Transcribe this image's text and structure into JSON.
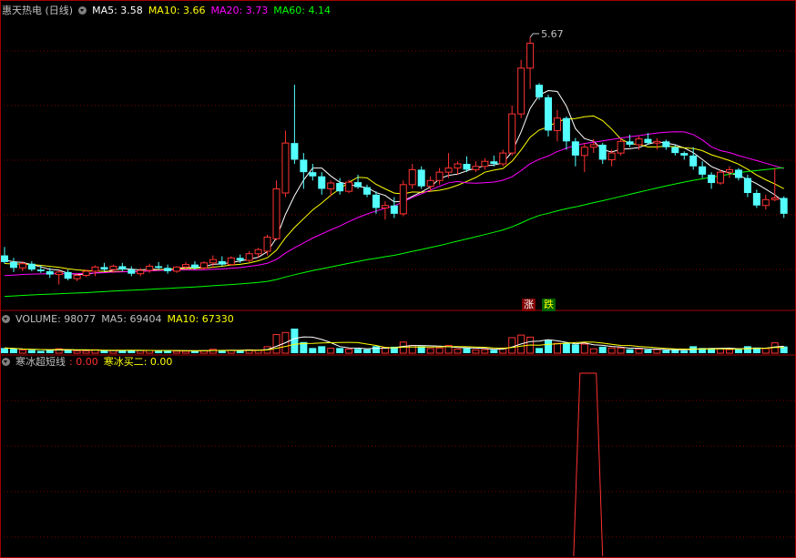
{
  "main_pane": {
    "title": "惠天热电 (日线)",
    "indicators": [
      {
        "label": "MA5: 3.58",
        "color": "#ffffff"
      },
      {
        "label": "MA10: 3.66",
        "color": "#ffff00"
      },
      {
        "label": "MA20: 3.73",
        "color": "#ff00ff"
      },
      {
        "label": "MA60: 4.14",
        "color": "#00ff00"
      }
    ],
    "high_label": "5.67",
    "tag_rise": "涨",
    "tag_fall": "跌"
  },
  "volume_pane": {
    "indicators": [
      {
        "label": "VOLUME: 98077",
        "color": "#c0c0c0"
      },
      {
        "label": "MA5: 69404",
        "color": "#c0c0c0"
      },
      {
        "label": "MA10: 67330",
        "color": "#ffff00"
      }
    ]
  },
  "indicator_pane": {
    "title": "寒冰超短线",
    "indicators": [
      {
        "label": ": 0.00",
        "color": "#ff3030"
      },
      {
        "label": "寒冰买二: 0.00",
        "color": "#ffff00"
      }
    ]
  },
  "colors": {
    "up": "#ff3232",
    "down": "#54ffff",
    "grid": "#800000",
    "border": "#a00000"
  },
  "chart_data": {
    "type": "candlestick",
    "y_visible_range": [
      2.4,
      5.9
    ],
    "candles_ohlc": [
      [
        3.05,
        3.15,
        2.95,
        2.97
      ],
      [
        2.97,
        3.02,
        2.85,
        2.9
      ],
      [
        2.9,
        2.98,
        2.86,
        2.95
      ],
      [
        2.95,
        2.98,
        2.86,
        2.88
      ],
      [
        2.88,
        2.93,
        2.84,
        2.86
      ],
      [
        2.86,
        2.9,
        2.78,
        2.82
      ],
      [
        2.82,
        2.87,
        2.7,
        2.85
      ],
      [
        2.85,
        2.88,
        2.75,
        2.77
      ],
      [
        2.77,
        2.83,
        2.74,
        2.81
      ],
      [
        2.81,
        2.88,
        2.79,
        2.86
      ],
      [
        2.86,
        2.93,
        2.8,
        2.91
      ],
      [
        2.91,
        2.96,
        2.86,
        2.88
      ],
      [
        2.88,
        2.94,
        2.84,
        2.92
      ],
      [
        2.92,
        2.96,
        2.86,
        2.88
      ],
      [
        2.88,
        2.92,
        2.8,
        2.83
      ],
      [
        2.83,
        2.9,
        2.8,
        2.87
      ],
      [
        2.87,
        2.95,
        2.84,
        2.92
      ],
      [
        2.92,
        2.97,
        2.88,
        2.9
      ],
      [
        2.9,
        2.94,
        2.83,
        2.86
      ],
      [
        2.86,
        2.92,
        2.84,
        2.91
      ],
      [
        2.91,
        2.97,
        2.89,
        2.94
      ],
      [
        2.94,
        2.98,
        2.88,
        2.9
      ],
      [
        2.9,
        2.98,
        2.88,
        2.96
      ],
      [
        2.96,
        3.05,
        2.9,
        3.0
      ],
      [
        2.98,
        3.04,
        2.92,
        2.94
      ],
      [
        2.94,
        3.04,
        2.93,
        3.02
      ],
      [
        3.02,
        3.06,
        2.96,
        2.99
      ],
      [
        2.99,
        3.1,
        2.97,
        3.07
      ],
      [
        3.07,
        3.14,
        3.02,
        3.12
      ],
      [
        3.1,
        3.3,
        3.05,
        3.27
      ],
      [
        3.25,
        3.95,
        3.23,
        3.85
      ],
      [
        3.8,
        4.55,
        3.75,
        4.4
      ],
      [
        4.4,
        5.1,
        4.15,
        4.2
      ],
      [
        4.2,
        4.28,
        3.85,
        4.05
      ],
      [
        4.05,
        4.15,
        3.95,
        4.0
      ],
      [
        4.0,
        4.05,
        3.78,
        3.85
      ],
      [
        3.85,
        3.95,
        3.76,
        3.92
      ],
      [
        3.92,
        3.98,
        3.78,
        3.82
      ],
      [
        3.82,
        3.96,
        3.8,
        3.93
      ],
      [
        3.93,
        4.02,
        3.85,
        3.87
      ],
      [
        3.87,
        3.9,
        3.75,
        3.78
      ],
      [
        3.78,
        3.82,
        3.55,
        3.62
      ],
      [
        3.62,
        3.7,
        3.48,
        3.65
      ],
      [
        3.65,
        3.75,
        3.5,
        3.55
      ],
      [
        3.55,
        3.95,
        3.52,
        3.9
      ],
      [
        3.9,
        4.15,
        3.85,
        4.08
      ],
      [
        4.08,
        4.12,
        3.85,
        3.88
      ],
      [
        3.88,
        4.0,
        3.82,
        3.95
      ],
      [
        3.95,
        4.1,
        3.9,
        4.05
      ],
      [
        4.05,
        4.28,
        3.98,
        4.1
      ],
      [
        4.1,
        4.18,
        4.02,
        4.15
      ],
      [
        4.15,
        4.24,
        4.05,
        4.08
      ],
      [
        4.08,
        4.18,
        4.05,
        4.12
      ],
      [
        4.12,
        4.22,
        4.08,
        4.18
      ],
      [
        4.18,
        4.25,
        4.12,
        4.15
      ],
      [
        4.15,
        4.32,
        4.12,
        4.28
      ],
      [
        4.28,
        4.85,
        4.25,
        4.75
      ],
      [
        4.75,
        5.4,
        4.7,
        5.3
      ],
      [
        5.3,
        5.67,
        5.05,
        5.6
      ],
      [
        5.1,
        5.12,
        4.92,
        4.95
      ],
      [
        4.95,
        4.98,
        4.48,
        4.55
      ],
      [
        4.55,
        4.8,
        4.42,
        4.7
      ],
      [
        4.7,
        4.72,
        4.32,
        4.42
      ],
      [
        4.42,
        4.46,
        4.12,
        4.25
      ],
      [
        4.25,
        4.4,
        4.05,
        4.35
      ],
      [
        4.35,
        4.45,
        4.28,
        4.38
      ],
      [
        4.38,
        4.4,
        4.15,
        4.2
      ],
      [
        4.2,
        4.32,
        4.12,
        4.28
      ],
      [
        4.28,
        4.45,
        4.25,
        4.42
      ],
      [
        4.42,
        4.5,
        4.35,
        4.38
      ],
      [
        4.38,
        4.48,
        4.32,
        4.45
      ],
      [
        4.45,
        4.52,
        4.38,
        4.4
      ],
      [
        4.4,
        4.46,
        4.32,
        4.42
      ],
      [
        4.42,
        4.44,
        4.32,
        4.35
      ],
      [
        4.35,
        4.38,
        4.25,
        4.28
      ],
      [
        4.28,
        4.3,
        4.2,
        4.25
      ],
      [
        4.25,
        4.35,
        4.08,
        4.12
      ],
      [
        4.12,
        4.18,
        3.98,
        4.02
      ],
      [
        4.02,
        4.05,
        3.85,
        3.92
      ],
      [
        3.92,
        4.08,
        3.9,
        4.05
      ],
      [
        4.05,
        4.12,
        3.98,
        4.08
      ],
      [
        4.08,
        4.1,
        3.95,
        3.98
      ],
      [
        3.98,
        4.02,
        3.75,
        3.8
      ],
      [
        3.8,
        3.84,
        3.62,
        3.65
      ],
      [
        3.65,
        3.78,
        3.6,
        3.72
      ],
      [
        3.72,
        4.1,
        3.7,
        3.74
      ],
      [
        3.74,
        3.76,
        3.5,
        3.55
      ]
    ],
    "ma_last": {
      "MA5": 3.58,
      "MA10": 3.66,
      "MA20": 3.73,
      "MA60": 4.14
    },
    "volume_last": 98077,
    "volume_ma_last": {
      "MA5": 69404,
      "MA10": 67330
    },
    "indicator_values_last": {
      "寒冰超短线": 0.0,
      "寒冰买二": 0.0
    },
    "indicator_signal_range": [
      0,
      1
    ]
  }
}
